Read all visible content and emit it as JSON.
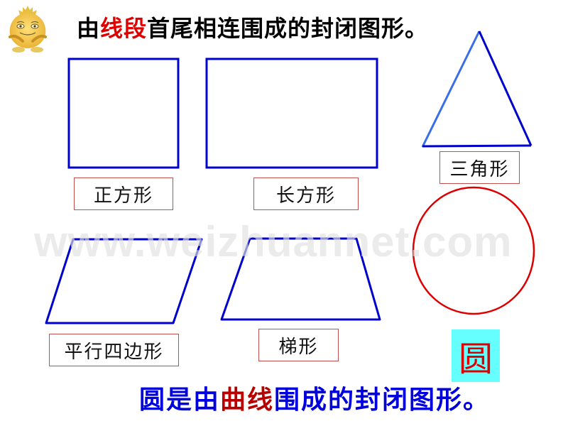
{
  "title": {
    "prefix": "由",
    "highlight": "线段",
    "suffix": "首尾相连围成的封闭图形。",
    "highlight_color": "#e00000"
  },
  "shapes": [
    {
      "name": "square",
      "label": "正方形",
      "stroke": "#0000cc"
    },
    {
      "name": "rectangle",
      "label": "长方形",
      "stroke": "#0000cc"
    },
    {
      "name": "triangle",
      "label": "三角形",
      "stroke": "#0000cc"
    },
    {
      "name": "parallelogram",
      "label": "平行四边形",
      "stroke": "#0000cc"
    },
    {
      "name": "trapezoid",
      "label": "梯形",
      "stroke": "#0000cc"
    },
    {
      "name": "circle",
      "label": "圆",
      "stroke": "#dd0000"
    }
  ],
  "summary": {
    "part1": "圆是由",
    "highlight": "曲线",
    "part2": "围成的封闭图形。",
    "text_color": "#0000dd",
    "highlight_color": "#b80000"
  },
  "watermark": "www.weizhuannet.com",
  "mascot_icon": "onion-mascot-icon"
}
